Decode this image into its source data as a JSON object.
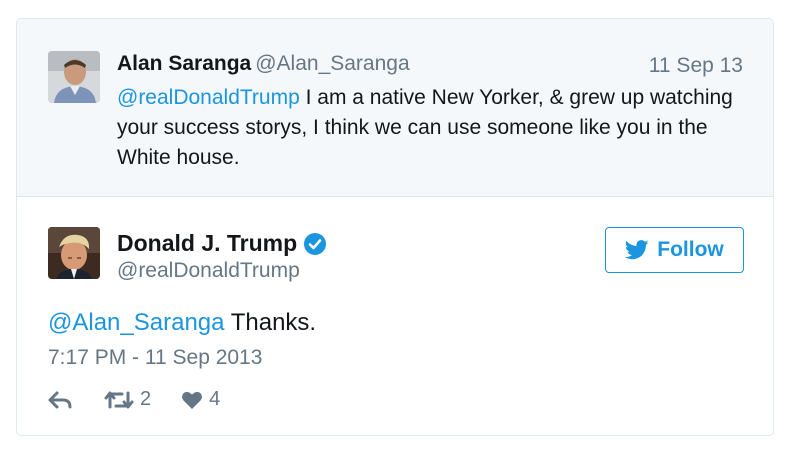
{
  "parent_tweet": {
    "name": "Alan Saranga",
    "screen_name": "@Alan_Saranga",
    "date": "11 Sep 13",
    "mention": "@realDonaldTrump",
    "text": " I am a native New Yorker, & grew up watching your success storys, I think we can use someone like you in the White house."
  },
  "tweet": {
    "name": "Donald J. Trump",
    "screen_name": "@realDonaldTrump",
    "mention": "@Alan_Saranga",
    "text": " Thanks.",
    "timestamp": "7:17 PM - 11 Sep 2013",
    "follow_label": "Follow",
    "retweet_count": "2",
    "like_count": "4"
  },
  "colors": {
    "accent": "#1b95e0",
    "muted": "#657786",
    "parent_bg": "#f5f8fa",
    "border": "#e1e8ed"
  },
  "icons": [
    "reply-icon",
    "retweet-icon",
    "heart-icon",
    "twitter-bird-icon",
    "verified-badge-icon"
  ]
}
